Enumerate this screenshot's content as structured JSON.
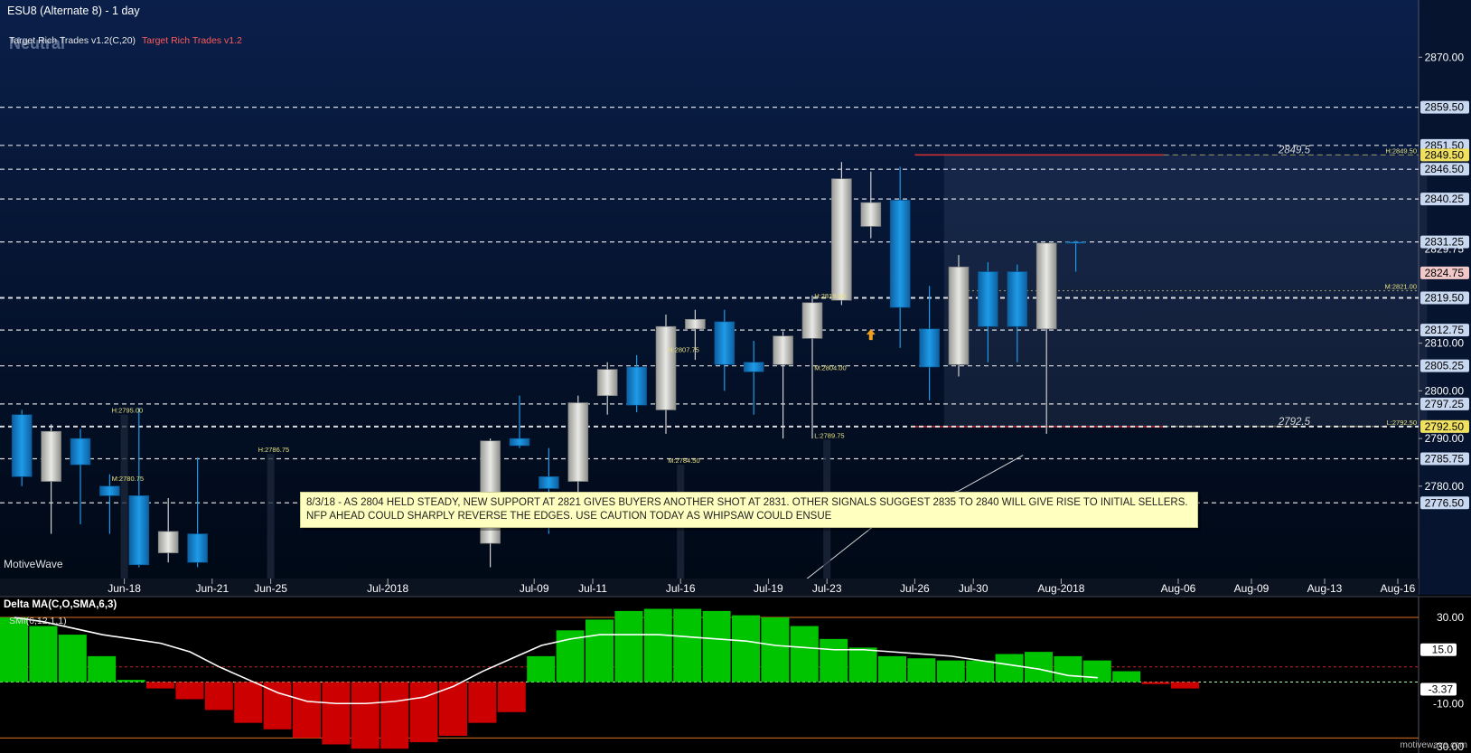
{
  "header": {
    "title": "ESU8 (Alternate 8) - 1 day",
    "indicator_label": "Target Rich Trades v1.2(C,20)",
    "indicator_label_red": "Target Rich Trades v1.2",
    "status": "Neutral",
    "watermark": "MotiveWave",
    "footer_watermark": "motivewave.com"
  },
  "note": {
    "text": "8/3/18 -  AS 2804 HELD STEADY, NEW SUPPORT AT 2821 GIVES BUYERS ANOTHER SHOT AT 2831.  OTHER SIGNALS SUGGEST 2835 TO 2840 WILL GIVE RISE TO INITIAL SELLERS.  NFP AHEAD COULD SHARPLY REVERSE THE EDGES.  USE CAUTION TODAY AS WHIPSAW COULD ENSUE"
  },
  "colors": {
    "bg_top": "#0a1f4a",
    "bg_bottom": "#000814",
    "up_candle": "#e8e8e4",
    "down_candle": "#1e9be8",
    "level_line": "#ffffff",
    "red_level": "#d83030",
    "dashed_khaki": "#a09860",
    "osc_up": "#00c400",
    "osc_down": "#cc0000",
    "orange_line": "#e07020",
    "axis_text": "#ffffff",
    "level_label_bg": "#c8d8f0",
    "level_label_pink": "#f0c8c8",
    "level_label_yellow": "#f0e060"
  },
  "chart_data": [
    {
      "type": "candlestick",
      "title": "ESU8 (Alternate 8) - 1 day",
      "ylim": [
        2761,
        2882
      ],
      "y_ticks": [
        "2870.00",
        "2810.00",
        "2800.00",
        "2790.00",
        "2780.00"
      ],
      "x_ticks": [
        {
          "label": "Jun-18",
          "x": 3.5
        },
        {
          "label": "Jun-21",
          "x": 6.5
        },
        {
          "label": "Jun-25",
          "x": 8.5
        },
        {
          "label": "Jul-2018",
          "x": 12.5
        },
        {
          "label": "Jul-09",
          "x": 17.5
        },
        {
          "label": "Jul-11",
          "x": 19.5
        },
        {
          "label": "Jul-16",
          "x": 22.5
        },
        {
          "label": "Jul-19",
          "x": 25.5
        },
        {
          "label": "Jul-23",
          "x": 27.5
        },
        {
          "label": "Jul-26",
          "x": 30.5
        },
        {
          "label": "Jul-30",
          "x": 32.5
        },
        {
          "label": "Aug-2018",
          "x": 35.5
        },
        {
          "label": "Aug-06",
          "x": 39.5
        },
        {
          "label": "Aug-09",
          "x": 42.0
        },
        {
          "label": "Aug-13",
          "x": 44.5
        },
        {
          "label": "Aug-16",
          "x": 47.0
        }
      ],
      "candles": [
        {
          "x": 0,
          "o": 2795.0,
          "h": 2796.0,
          "l": 2780.0,
          "c": 2782.0
        },
        {
          "x": 1,
          "o": 2781.0,
          "h": 2793.0,
          "l": 2770.0,
          "c": 2791.5
        },
        {
          "x": 2,
          "o": 2790.0,
          "h": 2792.0,
          "l": 2772.0,
          "c": 2784.5
        },
        {
          "x": 3,
          "o": 2780.0,
          "h": 2782.5,
          "l": 2770.0,
          "c": 2778.0
        },
        {
          "x": 4,
          "o": 2778.0,
          "h": 2796.5,
          "l": 2763.0,
          "c": 2763.5
        },
        {
          "x": 5,
          "o": 2766.0,
          "h": 2777.5,
          "l": 2764.0,
          "c": 2770.5
        },
        {
          "x": 6,
          "o": 2770.0,
          "h": 2786.0,
          "l": 2763.0,
          "c": 2764.0
        },
        {
          "x": 16,
          "o": 2768.0,
          "h": 2790.0,
          "l": 2763.0,
          "c": 2789.5
        },
        {
          "x": 17,
          "o": 2790.0,
          "h": 2799.0,
          "l": 2788.0,
          "c": 2788.5
        },
        {
          "x": 18,
          "o": 2782.0,
          "h": 2788.0,
          "l": 2770.0,
          "c": 2779.5
        },
        {
          "x": 19,
          "o": 2781.0,
          "h": 2799.0,
          "l": 2778.0,
          "c": 2797.5
        },
        {
          "x": 20,
          "o": 2799.0,
          "h": 2806.0,
          "l": 2795.0,
          "c": 2804.5
        },
        {
          "x": 21,
          "o": 2805.0,
          "h": 2807.5,
          "l": 2795.5,
          "c": 2797.0
        },
        {
          "x": 22,
          "o": 2796.0,
          "h": 2816.0,
          "l": 2791.0,
          "c": 2813.5
        },
        {
          "x": 23,
          "o": 2813.0,
          "h": 2817.0,
          "l": 2806.5,
          "c": 2815.0
        },
        {
          "x": 24,
          "o": 2814.5,
          "h": 2817.0,
          "l": 2800.0,
          "c": 2805.5
        },
        {
          "x": 25,
          "o": 2806.0,
          "h": 2810.5,
          "l": 2795.0,
          "c": 2804.0
        },
        {
          "x": 26,
          "o": 2805.5,
          "h": 2812.5,
          "l": 2790.0,
          "c": 2811.5
        },
        {
          "x": 27,
          "o": 2811.0,
          "h": 2820.0,
          "l": 2790.0,
          "c": 2818.5
        },
        {
          "x": 28,
          "o": 2819.0,
          "h": 2848.0,
          "l": 2818.0,
          "c": 2844.5
        },
        {
          "x": 29,
          "o": 2834.5,
          "h": 2846.0,
          "l": 2832.0,
          "c": 2839.5
        },
        {
          "x": 30,
          "o": 2840.0,
          "h": 2847.0,
          "l": 2809.0,
          "c": 2817.5
        },
        {
          "x": 31,
          "o": 2813.0,
          "h": 2822.0,
          "l": 2798.0,
          "c": 2805.0
        },
        {
          "x": 32,
          "o": 2805.5,
          "h": 2828.5,
          "l": 2803.0,
          "c": 2826.0
        },
        {
          "x": 33,
          "o": 2825.0,
          "h": 2827.0,
          "l": 2806.0,
          "c": 2813.5
        },
        {
          "x": 34,
          "o": 2825.0,
          "h": 2826.5,
          "l": 2806.0,
          "c": 2813.5
        },
        {
          "x": 35,
          "o": 2813.0,
          "h": 2831.0,
          "l": 2791.0,
          "c": 2831.0
        },
        {
          "x": 36,
          "o": 2831.25,
          "h": 2831.5,
          "l": 2825.0,
          "c": 2831.0
        }
      ],
      "level_lines": [
        2859.5,
        2851.5,
        2846.5,
        2840.25,
        2831.25,
        2819.5,
        2812.75,
        2805.25,
        2797.25,
        2792.5,
        2785.75,
        2776.5
      ],
      "right_axis_levels": [
        {
          "value": 2859.5,
          "label": "2859.50"
        },
        {
          "value": 2851.5,
          "label": "2851.50"
        },
        {
          "value": 2849.5,
          "label": "2849.50",
          "style": "yellow"
        },
        {
          "value": 2846.5,
          "label": "2846.50"
        },
        {
          "value": 2840.25,
          "label": "2840.25"
        },
        {
          "value": 2829.75,
          "label": "2829.75",
          "style": "plain"
        },
        {
          "value": 2831.25,
          "label": "2831.25"
        },
        {
          "value": 2824.75,
          "label": "2824.75",
          "style": "pink"
        },
        {
          "value": 2819.5,
          "label": "2819.50"
        },
        {
          "value": 2812.75,
          "label": "2812.75"
        },
        {
          "value": 2805.25,
          "label": "2805.25"
        },
        {
          "value": 2797.25,
          "label": "2797.25"
        },
        {
          "value": 2792.5,
          "label": "2792.50",
          "style": "yellow"
        },
        {
          "value": 2785.75,
          "label": "2785.75"
        },
        {
          "value": 2776.5,
          "label": "2776.50"
        }
      ],
      "annotations": [
        {
          "text": "2849.5",
          "value": 2849.5
        },
        {
          "text": "2792.5",
          "value": 2792.5
        },
        {
          "text": "H:2849.50",
          "value": 2849.5
        },
        {
          "text": "M:2821.00",
          "value": 2821.0
        },
        {
          "text": "L:2792.50",
          "value": 2792.5
        },
        {
          "text": "H:2795.00",
          "x": 3.5,
          "value": 2795.0
        },
        {
          "text": "M:2780.75",
          "x": 3.5,
          "value": 2780.75
        },
        {
          "text": "H:2786.75",
          "x": 8.5,
          "value": 2786.75
        },
        {
          "text": "M:2784.50",
          "x": 22.5,
          "value": 2784.5
        },
        {
          "text": "H:2807.75",
          "x": 22.5,
          "value": 2807.75
        },
        {
          "text": "M:2804.00",
          "x": 27.5,
          "value": 2804.0
        },
        {
          "text": "L:2789.75",
          "x": 27.5,
          "value": 2789.75
        },
        {
          "text": "H:2819.00",
          "x": 27.5,
          "value": 2819.0
        }
      ],
      "zone": {
        "x_start": 32.0,
        "x_end": 48.5,
        "y_top": 2849.5,
        "y_bottom": 2792.5
      }
    },
    {
      "type": "bar",
      "title": "Delta MA(C,O,SMA,6,3)",
      "secondary_label": "SMI(6,12,1,1)",
      "ylim": [
        -33,
        38
      ],
      "y_ticks": [
        "30.00",
        "-10.00",
        "-30.00"
      ],
      "reference_lines": [
        30.0,
        0.0,
        -26.0
      ],
      "axis_markers": [
        {
          "value": 15.0,
          "label": "15.0"
        },
        {
          "value": -3.37,
          "label": "-3.37"
        }
      ],
      "values": [
        30,
        26,
        22,
        12,
        1,
        -3,
        -8,
        -13,
        -19,
        -22,
        -26,
        -29,
        -31,
        -31,
        -28,
        -25,
        -19,
        -14,
        12,
        24,
        29,
        33,
        34,
        34,
        33,
        31,
        30,
        26,
        20,
        16,
        12,
        11,
        10,
        10,
        13,
        14,
        12,
        10,
        5,
        -1,
        -3
      ],
      "smi_line": [
        30,
        28,
        25,
        22,
        20,
        18,
        14,
        7,
        1,
        -5,
        -9,
        -10,
        -10,
        -9,
        -7,
        -2,
        5,
        11,
        17,
        20,
        22,
        22,
        22,
        21,
        20,
        19,
        17,
        16,
        15,
        15,
        14,
        13,
        12,
        10,
        8,
        6,
        3,
        2
      ]
    }
  ]
}
